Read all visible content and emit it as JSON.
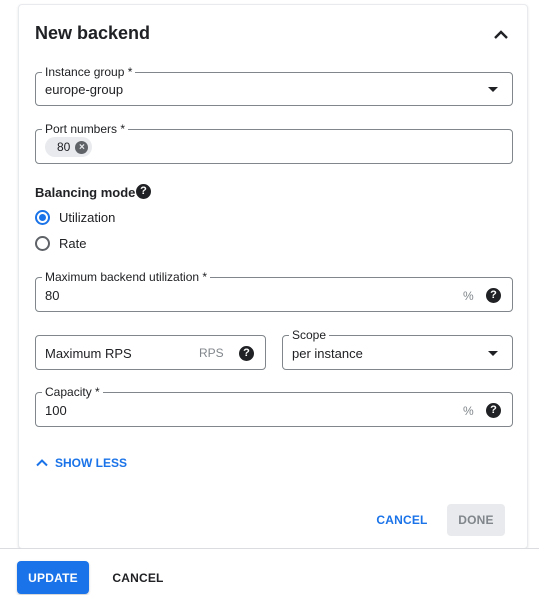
{
  "card": {
    "title": "New backend",
    "collapse_icon": "chevron-up-icon"
  },
  "instance_group": {
    "label": "Instance group *",
    "value": "europe-group",
    "icon": "caret-down-icon"
  },
  "port_numbers": {
    "label": "Port numbers *",
    "chips": [
      "80"
    ],
    "chip_remove_icon": "close-circle-icon"
  },
  "balancing_mode": {
    "label": "Balancing mode",
    "help_icon": "help-icon",
    "options": [
      {
        "label": "Utilization",
        "checked": true
      },
      {
        "label": "Rate",
        "checked": false
      }
    ]
  },
  "max_utilization": {
    "label": "Maximum backend utilization *",
    "value": "80",
    "unit": "%",
    "help_icon": "help-icon"
  },
  "max_rps": {
    "placeholder": "Maximum RPS",
    "unit": "RPS",
    "help_icon": "help-icon"
  },
  "scope": {
    "label": "Scope",
    "value": "per instance",
    "icon": "caret-down-icon"
  },
  "capacity": {
    "label": "Capacity *",
    "value": "100",
    "unit": "%",
    "help_icon": "help-icon"
  },
  "show_less": {
    "label": "SHOW LESS",
    "icon": "chevron-up-icon"
  },
  "card_actions": {
    "cancel": "CANCEL",
    "done": "DONE"
  },
  "footer": {
    "update": "UPDATE",
    "cancel": "CANCEL"
  },
  "colors": {
    "accent": "#1a73e8",
    "text": "#202124",
    "muted": "#80868b",
    "disabled_bg": "#e8eaed"
  }
}
